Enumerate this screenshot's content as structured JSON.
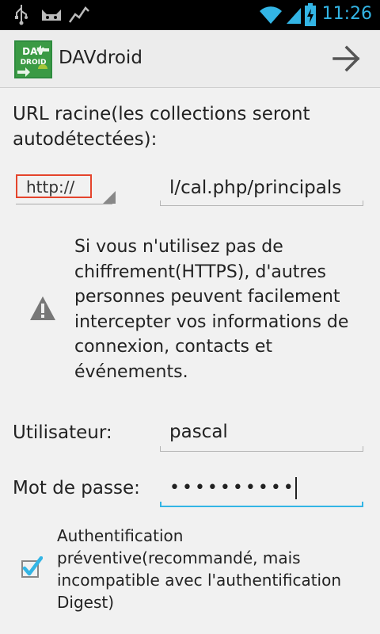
{
  "status_bar": {
    "time": "11:26",
    "icons": [
      "usb-icon",
      "android-debug-icon",
      "activity-icon",
      "wifi-icon",
      "signal-icon",
      "battery-charging-icon"
    ]
  },
  "action_bar": {
    "title": "DAVdroid",
    "logo_text_top": "DAV",
    "logo_text_bottom": "DROID",
    "next_icon": "arrow-right-icon"
  },
  "form": {
    "url_label": "URL racine(les collections seront autodétectées):",
    "scheme_selected": "http://",
    "url_value": "l/cal.php/principals",
    "warning_icon": "warning-icon",
    "warning_text": "Si vous n'utilisez pas de chiffrement(HTTPS), d'autres personnes peuvent facilement intercepter vos informations de connexion, contacts et événements.",
    "user_label": "Utilisateur:",
    "user_value": "pascal",
    "password_label": "Mot de passe:",
    "password_value": "••••••••••",
    "preemptive_label": "Authentification préventive(recommandé, mais incompatible avec l'authentification Digest)",
    "preemptive_checked": true
  },
  "colors": {
    "accent": "#33b5e5",
    "highlight_box": "#e4442c",
    "logo_green": "#2e8b3e"
  }
}
